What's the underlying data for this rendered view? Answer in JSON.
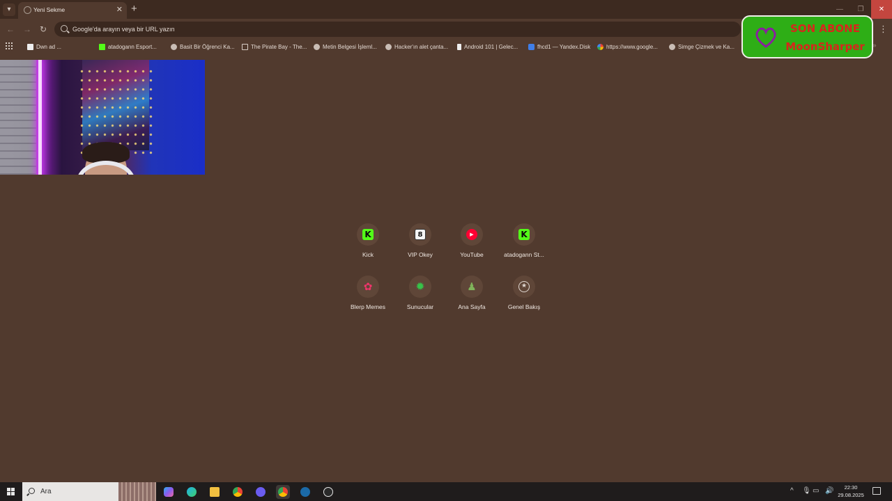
{
  "tab": {
    "title": "Yeni Sekme"
  },
  "omnibox": {
    "placeholder": "Google'da arayın veya bir URL yazın",
    "display_text": "Google'da arayın veya bir URL yazın"
  },
  "bookmarks": [
    {
      "label": "Dwn ad ... ",
      "icon": "blank-page-icon"
    },
    {
      "label": "atadogann Esport...",
      "icon": "kick-icon"
    },
    {
      "label": "Basit Bir Öğrenci Ka...",
      "icon": "globe-icon"
    },
    {
      "label": "The Pirate Bay - The...",
      "icon": "pirate-bay-icon"
    },
    {
      "label": "Metin Belgesi İşleml...",
      "icon": "globe-icon"
    },
    {
      "label": "Hacker'ın alet çanta...",
      "icon": "globe-icon"
    },
    {
      "label": "Android 101 | Gelec...",
      "icon": "doc-icon"
    },
    {
      "label": "fhcd1 — Yandex.Disk",
      "icon": "yandex-disk-icon"
    },
    {
      "label": "https://www.google...",
      "icon": "google-icon"
    },
    {
      "label": "Simge Çizmek ve Ka...",
      "icon": "globe-icon"
    }
  ],
  "subscriber_badge": {
    "line1": "SON ABONE",
    "line2": "MoonSharper",
    "heart_color": "#8a1fa0",
    "bg_color": "#2eae16",
    "text_color": "#d8261c"
  },
  "shortcuts": [
    {
      "label": "Kick",
      "glyph": "K",
      "icon": "kick-icon"
    },
    {
      "label": "VIP Okey",
      "glyph": "8",
      "icon": "vip-okey-icon"
    },
    {
      "label": "YouTube",
      "glyph": "▶",
      "icon": "youtube-icon"
    },
    {
      "label": "atadogann St...",
      "glyph": "K",
      "icon": "kick-icon"
    },
    {
      "label": "Blerp Memes",
      "glyph": "✿",
      "icon": "blerp-icon"
    },
    {
      "label": "Sunucular",
      "glyph": "✹",
      "icon": "server-icon"
    },
    {
      "label": "Ana Sayfa",
      "glyph": "♟",
      "icon": "pawn-icon"
    },
    {
      "label": "Genel Bakış",
      "glyph": "★",
      "icon": "star-circle-icon"
    }
  ],
  "taskbar": {
    "search_text": "Ara",
    "clock_time": "22:30",
    "clock_date": "29.08.2025",
    "apps": [
      "copilot-icon",
      "edge-icon",
      "file-explorer-icon",
      "chrome-icon",
      "discord-icon",
      "chrome-active-icon",
      "steam-icon",
      "obs-icon"
    ]
  },
  "colors": {
    "page_bg": "#513a2e",
    "tabbar_bg": "#3d2a20",
    "taskbar_bg": "#1f1c1c"
  }
}
